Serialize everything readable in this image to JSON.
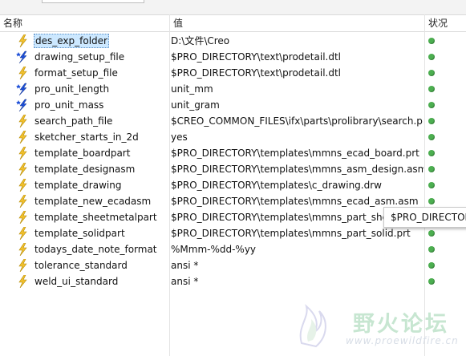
{
  "columns": {
    "name": "名称",
    "value": "值",
    "status": "状况"
  },
  "rows": [
    {
      "name": "des_exp_folder",
      "value": "D:\\文件\\Creo",
      "icon": "lightning-icon",
      "selected": true
    },
    {
      "name": "drawing_setup_file",
      "value": "$PRO_DIRECTORY\\text\\prodetail.dtl",
      "icon": "star-lightning-icon"
    },
    {
      "name": "format_setup_file",
      "value": "$PRO_DIRECTORY\\text\\prodetail.dtl",
      "icon": "lightning-icon"
    },
    {
      "name": "pro_unit_length",
      "value": "unit_mm",
      "icon": "star-lightning-icon"
    },
    {
      "name": "pro_unit_mass",
      "value": "unit_gram",
      "icon": "star-lightning-icon"
    },
    {
      "name": "search_path_file",
      "value": "$CREO_COMMON_FILES\\ifx\\parts\\prolibrary\\search.pro",
      "icon": "lightning-icon"
    },
    {
      "name": "sketcher_starts_in_2d",
      "value": "yes",
      "icon": "lightning-icon"
    },
    {
      "name": "template_boardpart",
      "value": "$PRO_DIRECTORY\\templates\\mmns_ecad_board.prt",
      "icon": "lightning-icon"
    },
    {
      "name": "template_designasm",
      "value": "$PRO_DIRECTORY\\templates\\mmns_asm_design.asm",
      "icon": "lightning-icon"
    },
    {
      "name": "template_drawing",
      "value": "$PRO_DIRECTORY\\templates\\c_drawing.drw",
      "icon": "lightning-icon"
    },
    {
      "name": "template_new_ecadasm",
      "value": "$PRO_DIRECTORY\\templates\\mmns_ecad_asm.asm",
      "icon": "lightning-icon"
    },
    {
      "name": "template_sheetmetalpart",
      "value": "$PRO_DIRECTORY\\templates\\mmns_part_sheetmetal.prt",
      "icon": "lightning-icon"
    },
    {
      "name": "template_solidpart",
      "value": "$PRO_DIRECTORY\\templates\\mmns_part_solid.prt",
      "icon": "lightning-icon"
    },
    {
      "name": "todays_date_note_format",
      "value": "%Mmm-%dd-%yy",
      "icon": "lightning-icon"
    },
    {
      "name": "tolerance_standard",
      "value": "ansi *",
      "icon": "lightning-icon"
    },
    {
      "name": "weld_ui_standard",
      "value": "ansi *",
      "icon": "lightning-icon"
    }
  ],
  "tooltip": "$PRO_DIRECTORY",
  "watermark": {
    "text": "野火论坛",
    "url": "www.proewildfire.cn"
  },
  "colors": {
    "status_ok": "#4caf50",
    "lightning": "#f2c12e",
    "star": "#1d4fd8",
    "selection": "#cce8ff"
  }
}
